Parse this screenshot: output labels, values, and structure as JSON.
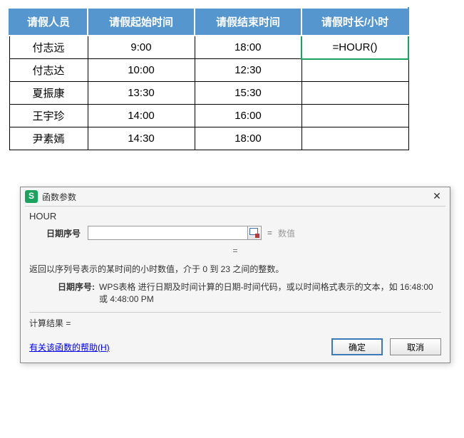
{
  "table": {
    "headers": [
      "请假人员",
      "请假起始时间",
      "请假结束时间",
      "请假时长/小时"
    ],
    "rows": [
      {
        "name": "付志远",
        "start": "9:00",
        "end": "18:00",
        "dur": "=HOUR()"
      },
      {
        "name": "付志达",
        "start": "10:00",
        "end": "12:30",
        "dur": ""
      },
      {
        "name": "夏振康",
        "start": "13:30",
        "end": "15:30",
        "dur": ""
      },
      {
        "name": "王宇珍",
        "start": "14:00",
        "end": "16:00",
        "dur": ""
      },
      {
        "name": "尹素嫣",
        "start": "14:30",
        "end": "18:00",
        "dur": ""
      }
    ]
  },
  "dialog": {
    "title": "函数参数",
    "func_name": "HOUR",
    "param_label": "日期序号",
    "param_input_value": "",
    "eq": "=",
    "param_value_placeholder": "数值",
    "description": "返回以序列号表示的某时间的小时数值，介于 0 到 23 之间的整数。",
    "param_desc_label": "日期序号:",
    "param_desc_text": "WPS表格 进行日期及时间计算的日期-时间代码，或以时间格式表示的文本，如 16:48:00 或 4:48:00 PM",
    "calc_result_label": "计算结果 =",
    "calc_result_value": "",
    "help_link": "有关该函数的帮助(H)",
    "ok_button": "确定",
    "cancel_button": "取消"
  }
}
